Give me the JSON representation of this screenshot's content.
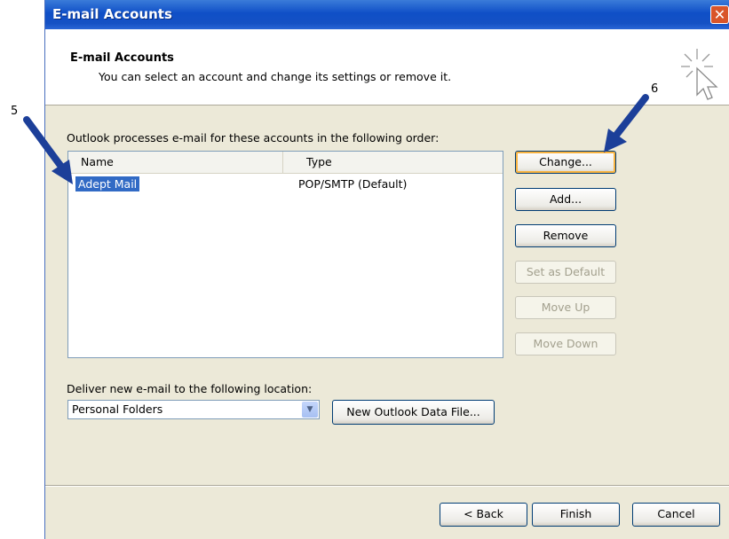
{
  "window": {
    "title": "E-mail Accounts"
  },
  "header": {
    "title": "E-mail Accounts",
    "subtitle": "You can select an account and change its settings or remove it."
  },
  "callouts": [
    "5",
    "6"
  ],
  "accounts": {
    "label": "Outlook processes e-mail for these accounts in the following order:",
    "columns": [
      "Name",
      "Type"
    ],
    "rows": [
      {
        "name": "Adept Mail",
        "type": "POP/SMTP (Default)",
        "selected": true
      }
    ]
  },
  "side_buttons": {
    "change": "Change...",
    "add": "Add...",
    "remove": "Remove",
    "set_default": "Set as Default",
    "move_up": "Move Up",
    "move_down": "Move Down"
  },
  "deliver": {
    "label": "Deliver new e-mail to the following location:",
    "selected": "Personal Folders",
    "new_file_button": "New Outlook Data File..."
  },
  "footer": {
    "back": "< Back",
    "finish": "Finish",
    "cancel": "Cancel"
  },
  "colors": {
    "titlebar": "#0f4fc7",
    "selection": "#316ac5",
    "arrow": "#1c3f99"
  }
}
